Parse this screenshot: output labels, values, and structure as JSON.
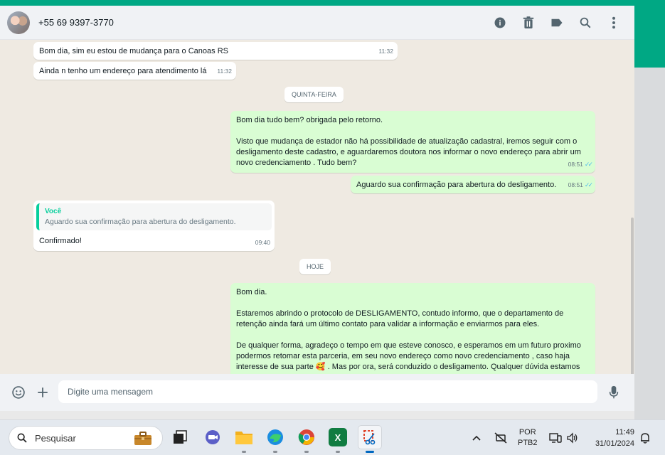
{
  "header": {
    "contact_name": "+55 69 9397-3770",
    "icons": [
      "info-icon",
      "trash-icon",
      "label-icon",
      "search-icon",
      "menu-dots-icon"
    ]
  },
  "messages": {
    "m1": {
      "text": "Bom dia, sim eu estou de mudança para o Canoas RS",
      "time": "11:32"
    },
    "m2": {
      "text": "Ainda n tenho um endereço para atendimento lá",
      "time": "11:32"
    },
    "date1": "QUINTA-FEIRA",
    "m3": {
      "p1": "Bom dia tudo bem? obrigada pelo retorno.",
      "p2": "Visto que mudança de estador não há possibilidade de atualização cadastral, iremos seguir com o desligamento deste cadastro, e aguardaremos doutora nos informar o novo endereço para abrir um novo credenciamento . Tudo bem?",
      "time": "08:51"
    },
    "m4": {
      "text": "Aguardo sua confirmação para abertura do desligamento.",
      "time": "08:51"
    },
    "m5": {
      "quote_author": "Você",
      "quote_text": "Aguardo sua confirmação para abertura do desligamento.",
      "text": "Confirmado!",
      "time": "09:40"
    },
    "date2": "HOJE",
    "m6": {
      "p1": "Bom dia.",
      "p2": "Estaremos abrindo o protocolo de DESLIGAMENTO, contudo informo, que o departamento de retenção ainda fará um último contato para validar a informação e enviarmos para eles.",
      "p3a": "De qualquer forma, agradeço o tempo em que esteve conosco, e esperamos em um futuro proximo podermos retomar esta parceria, em seu novo endereço como novo credenciamento , caso haja interesse de sua parte",
      "emoji": "🥰",
      "p3b": ". Mas por ora, será conduzido o desligamento. Qualquer dúvida estamos"
    }
  },
  "compose": {
    "placeholder": "Digite uma mensagem",
    "icons": [
      "emoji-icon",
      "plus-icon",
      "microphone-icon"
    ]
  },
  "taskbar": {
    "search_placeholder": "Pesquisar",
    "language_top": "POR",
    "language_bottom": "PTB2",
    "clock_time": "11:49",
    "clock_date": "31/01/2024"
  },
  "colors": {
    "accent": "#00a884",
    "outgoing_bubble": "#d9fdd3",
    "incoming_bubble": "#ffffff",
    "chat_background": "#efeae2",
    "read_ticks": "#53bdeb"
  }
}
